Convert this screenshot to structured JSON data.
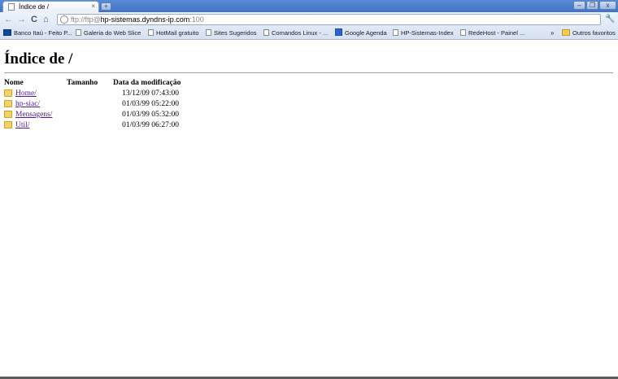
{
  "tab": {
    "title": "Índice de /",
    "close": "×",
    "new_tab": "+"
  },
  "window": {
    "minimize": "–",
    "maximize": "❐",
    "close": "x"
  },
  "toolbar": {
    "back": "←",
    "forward": "→",
    "reload": "C",
    "home": "⌂",
    "url_prefix": "ftp://ftp@",
    "url_host": "hp-sistemas.dyndns-ip.com",
    "url_suffix": ":100",
    "wrench": "🔧"
  },
  "bookmarks": [
    {
      "label": "Banco Itaú - Feito P...",
      "icon": "itau-icon"
    },
    {
      "label": "Galeria do Web Slice",
      "icon": "page-icon"
    },
    {
      "label": "HotMail gratuito",
      "icon": "page-icon"
    },
    {
      "label": "Sites Sugeridos",
      "icon": "page-icon"
    },
    {
      "label": "Comandos Linux - ...",
      "icon": "page-icon"
    },
    {
      "label": "Google Agenda",
      "icon": "calendar-icon"
    },
    {
      "label": "HP-Sistemas-Index",
      "icon": "page-icon"
    },
    {
      "label": "RedeHost - Painel ...",
      "icon": "page-icon"
    }
  ],
  "bookmarks_more": "»",
  "other_bookmarks": "Outros favoritos",
  "page": {
    "title": "Índice de /",
    "columns": {
      "name": "Nome",
      "size": "Tamanho",
      "date": "Data da modificação"
    },
    "rows": [
      {
        "name": "Home/",
        "date": "13/12/09 07:43:00"
      },
      {
        "name": "hp-siac/",
        "date": "01/03/99 05:22:00"
      },
      {
        "name": "Mensagens/",
        "date": "01/03/99 05:32:00"
      },
      {
        "name": "Util/",
        "date": "01/03/99 06:27:00"
      }
    ]
  },
  "colors": {
    "titlebar": "#3f74c8",
    "link_visited": "#551a8b",
    "folder": "#f3d365"
  }
}
